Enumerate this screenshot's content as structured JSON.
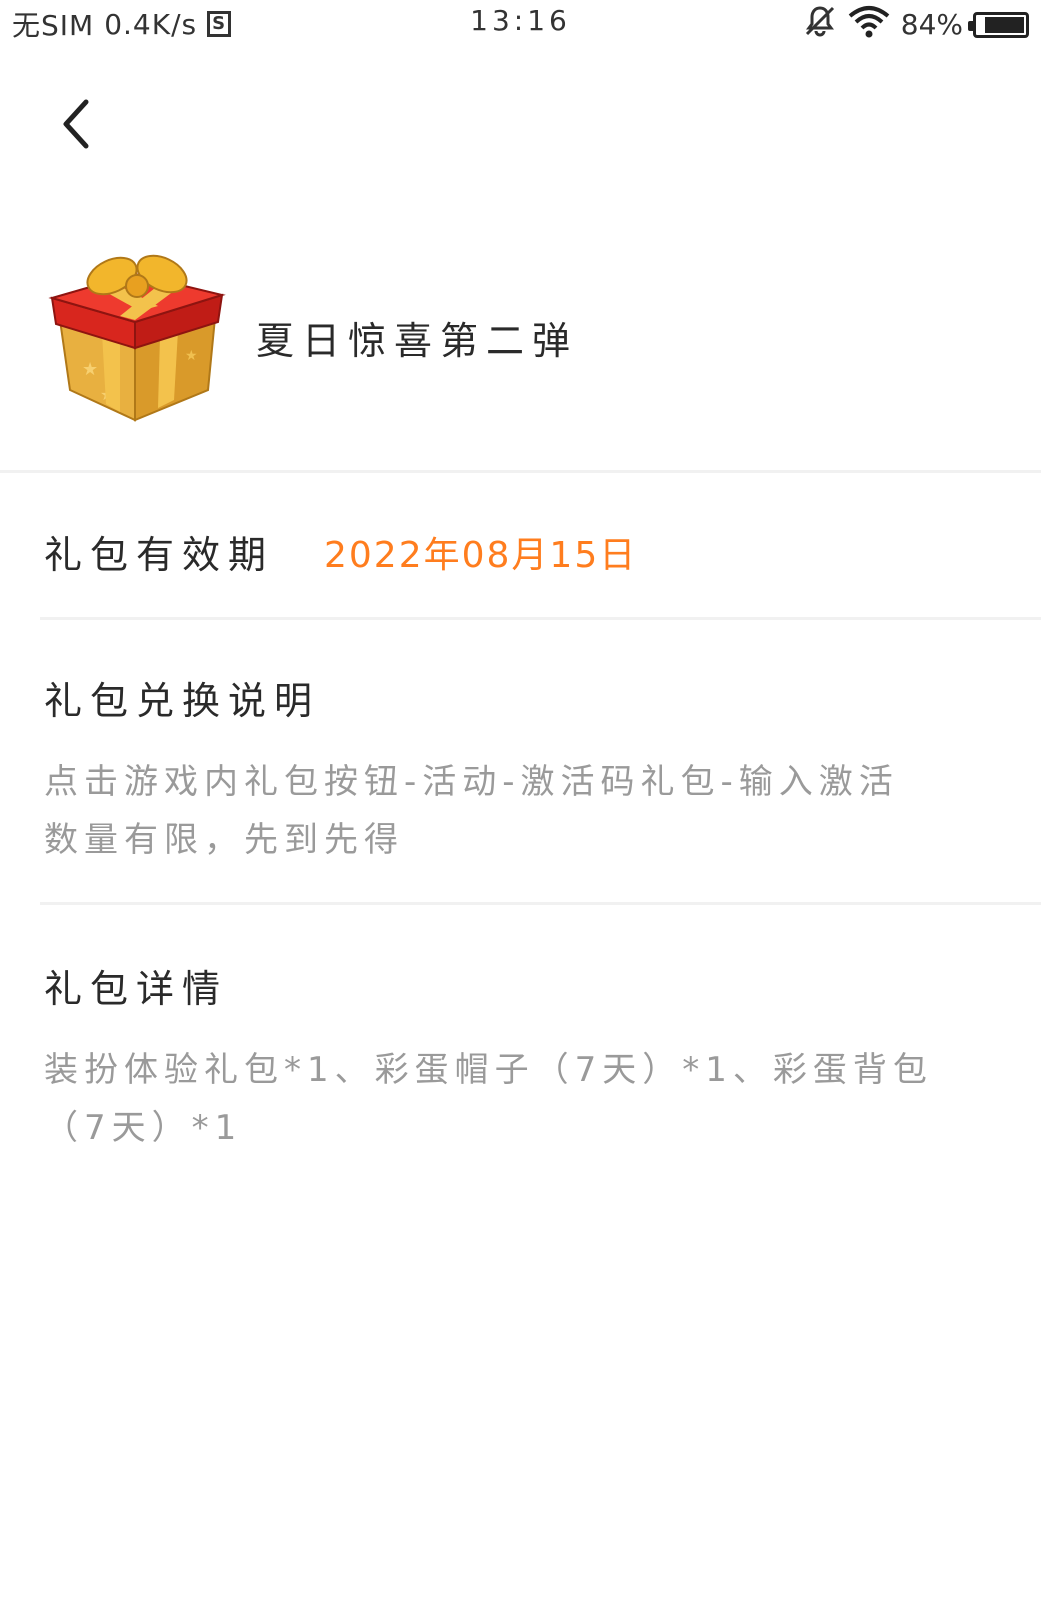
{
  "status_bar": {
    "carrier": "无SIM",
    "speed": "0.4K/s",
    "sim_badge": "S",
    "time": "13:16",
    "battery_text": "84%",
    "battery_level": 0.84,
    "icons": [
      "mute-bell-icon",
      "wifi-icon",
      "battery-icon"
    ]
  },
  "nav": {
    "back_icon": "chevron-left-icon"
  },
  "gift": {
    "icon": "gift-box-icon",
    "title": "夏日惊喜第二弹"
  },
  "validity": {
    "label": "礼包有效期",
    "value": "2022年08月15日",
    "value_color": "#ff7d1e"
  },
  "redeem": {
    "title": "礼包兑换说明",
    "body": "点击游戏内礼包按钮-活动-激活码礼包-输入激活\n数量有限，先到先得"
  },
  "details": {
    "title": "礼包详情",
    "body": "装扮体验礼包*1、彩蛋帽子（7天）*1、彩蛋背包\n（7天）*1"
  }
}
